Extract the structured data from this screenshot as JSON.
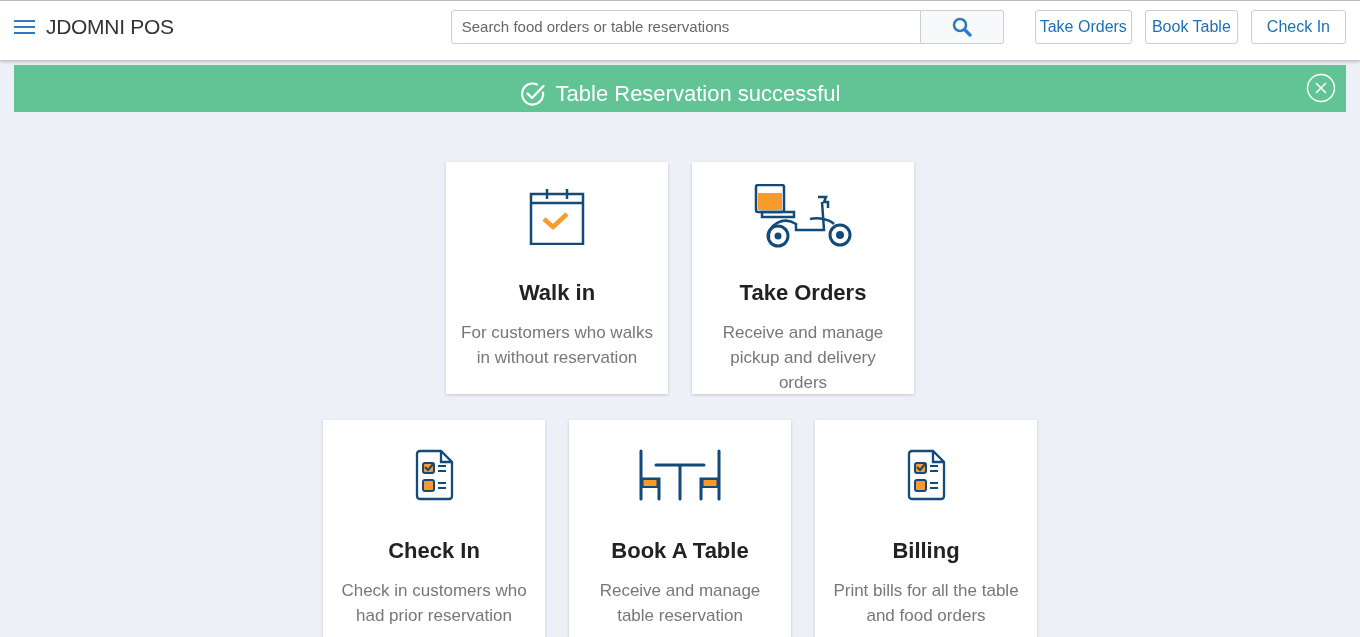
{
  "header": {
    "brand": "JDOMNI POS",
    "search": {
      "placeholder": "Search food orders or table reservations"
    },
    "buttons": [
      "Take Orders",
      "Book Table",
      "Check In"
    ]
  },
  "alert": {
    "message": "Table Reservation successful"
  },
  "card_rows": [
    [
      {
        "kind": "calendar",
        "title": "Walk in",
        "description": "For customers who walks in without reservation"
      },
      {
        "kind": "scooter",
        "title": "Take Orders",
        "description": "Receive and manage pickup and delivery orders"
      }
    ],
    [
      {
        "kind": "checklist",
        "title": "Check In",
        "description": "Check in customers who had prior reservation"
      },
      {
        "kind": "table",
        "title": "Book A Table",
        "description": "Receive and manage table reservation"
      },
      {
        "kind": "checklist",
        "title": "Billing",
        "description": "Print bills for all the table and food orders"
      }
    ]
  ]
}
